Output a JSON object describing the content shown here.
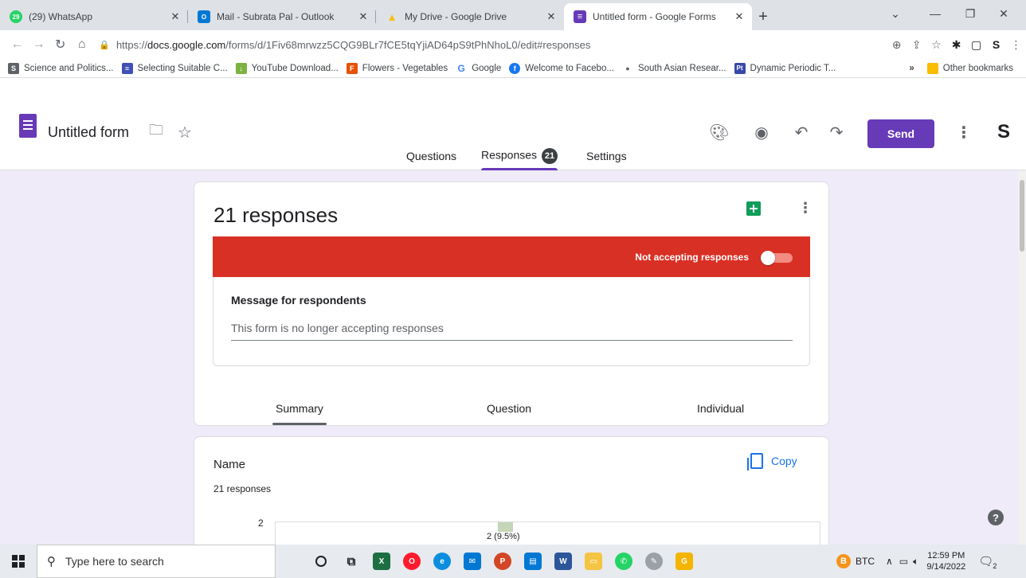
{
  "browser": {
    "tabs": [
      {
        "title": "(29) WhatsApp",
        "badge": "29",
        "color": "#25d366",
        "active": false
      },
      {
        "title": "Mail - Subrata Pal - Outlook",
        "badge": "O",
        "color": "#0078d4",
        "active": false
      },
      {
        "title": "My Drive - Google Drive",
        "badge": "▲",
        "color": "#fbbc04",
        "active": false
      },
      {
        "title": "Untitled form - Google Forms",
        "badge": "≡",
        "color": "#673ab7",
        "active": true
      }
    ],
    "url_prefix": "https://",
    "url_domain": "docs.google.com",
    "url_path": "/forms/d/1Fiv68mrwzz5CQG9BLr7fCE5tqYjiAD64pS9tPhNhoL0/edit#responses",
    "bookmarks": [
      {
        "label": "Science and Politics...",
        "color": "#5f6368",
        "glyph": "S"
      },
      {
        "label": "Selecting Suitable C...",
        "color": "#3f51b5",
        "glyph": "≡"
      },
      {
        "label": "YouTube Download...",
        "color": "#7cb342",
        "glyph": "↓"
      },
      {
        "label": "Flowers - Vegetables",
        "color": "#e65100",
        "glyph": "F"
      },
      {
        "label": "Google",
        "color": "#4285f4",
        "glyph": "G"
      },
      {
        "label": "Welcome to Facebo...",
        "color": "#1877f2",
        "glyph": "f"
      },
      {
        "label": "South Asian Resear...",
        "color": "#5f6368",
        "glyph": "●"
      },
      {
        "label": "Dynamic Periodic T...",
        "color": "#3949ab",
        "glyph": "Pt"
      }
    ],
    "more_bookmarks": "»",
    "other_bookmarks": "Other bookmarks"
  },
  "forms": {
    "title": "Untitled form",
    "send_label": "Send",
    "tabs": {
      "questions": "Questions",
      "responses": "Responses",
      "responses_count": "21",
      "settings": "Settings"
    },
    "accent": "#673ab7"
  },
  "responses": {
    "heading": "21 responses",
    "status_text": "Not accepting responses",
    "status_color": "#d93025",
    "message_label": "Message for respondents",
    "message_value": "This form is no longer accepting responses",
    "subtabs": {
      "summary": "Summary",
      "question": "Question",
      "individual": "Individual"
    }
  },
  "question_card": {
    "title": "Name",
    "count": "21 responses",
    "copy_label": "Copy"
  },
  "chart_data": {
    "type": "bar",
    "y_ticks": [
      "2"
    ],
    "bars": [
      {
        "value": 2,
        "label": "2 (9.5%)"
      }
    ]
  },
  "taskbar": {
    "search_placeholder": "Type here to search",
    "btc_label": "BTC",
    "time": "12:59 PM",
    "date": "9/14/2022",
    "notification_count": "2"
  }
}
